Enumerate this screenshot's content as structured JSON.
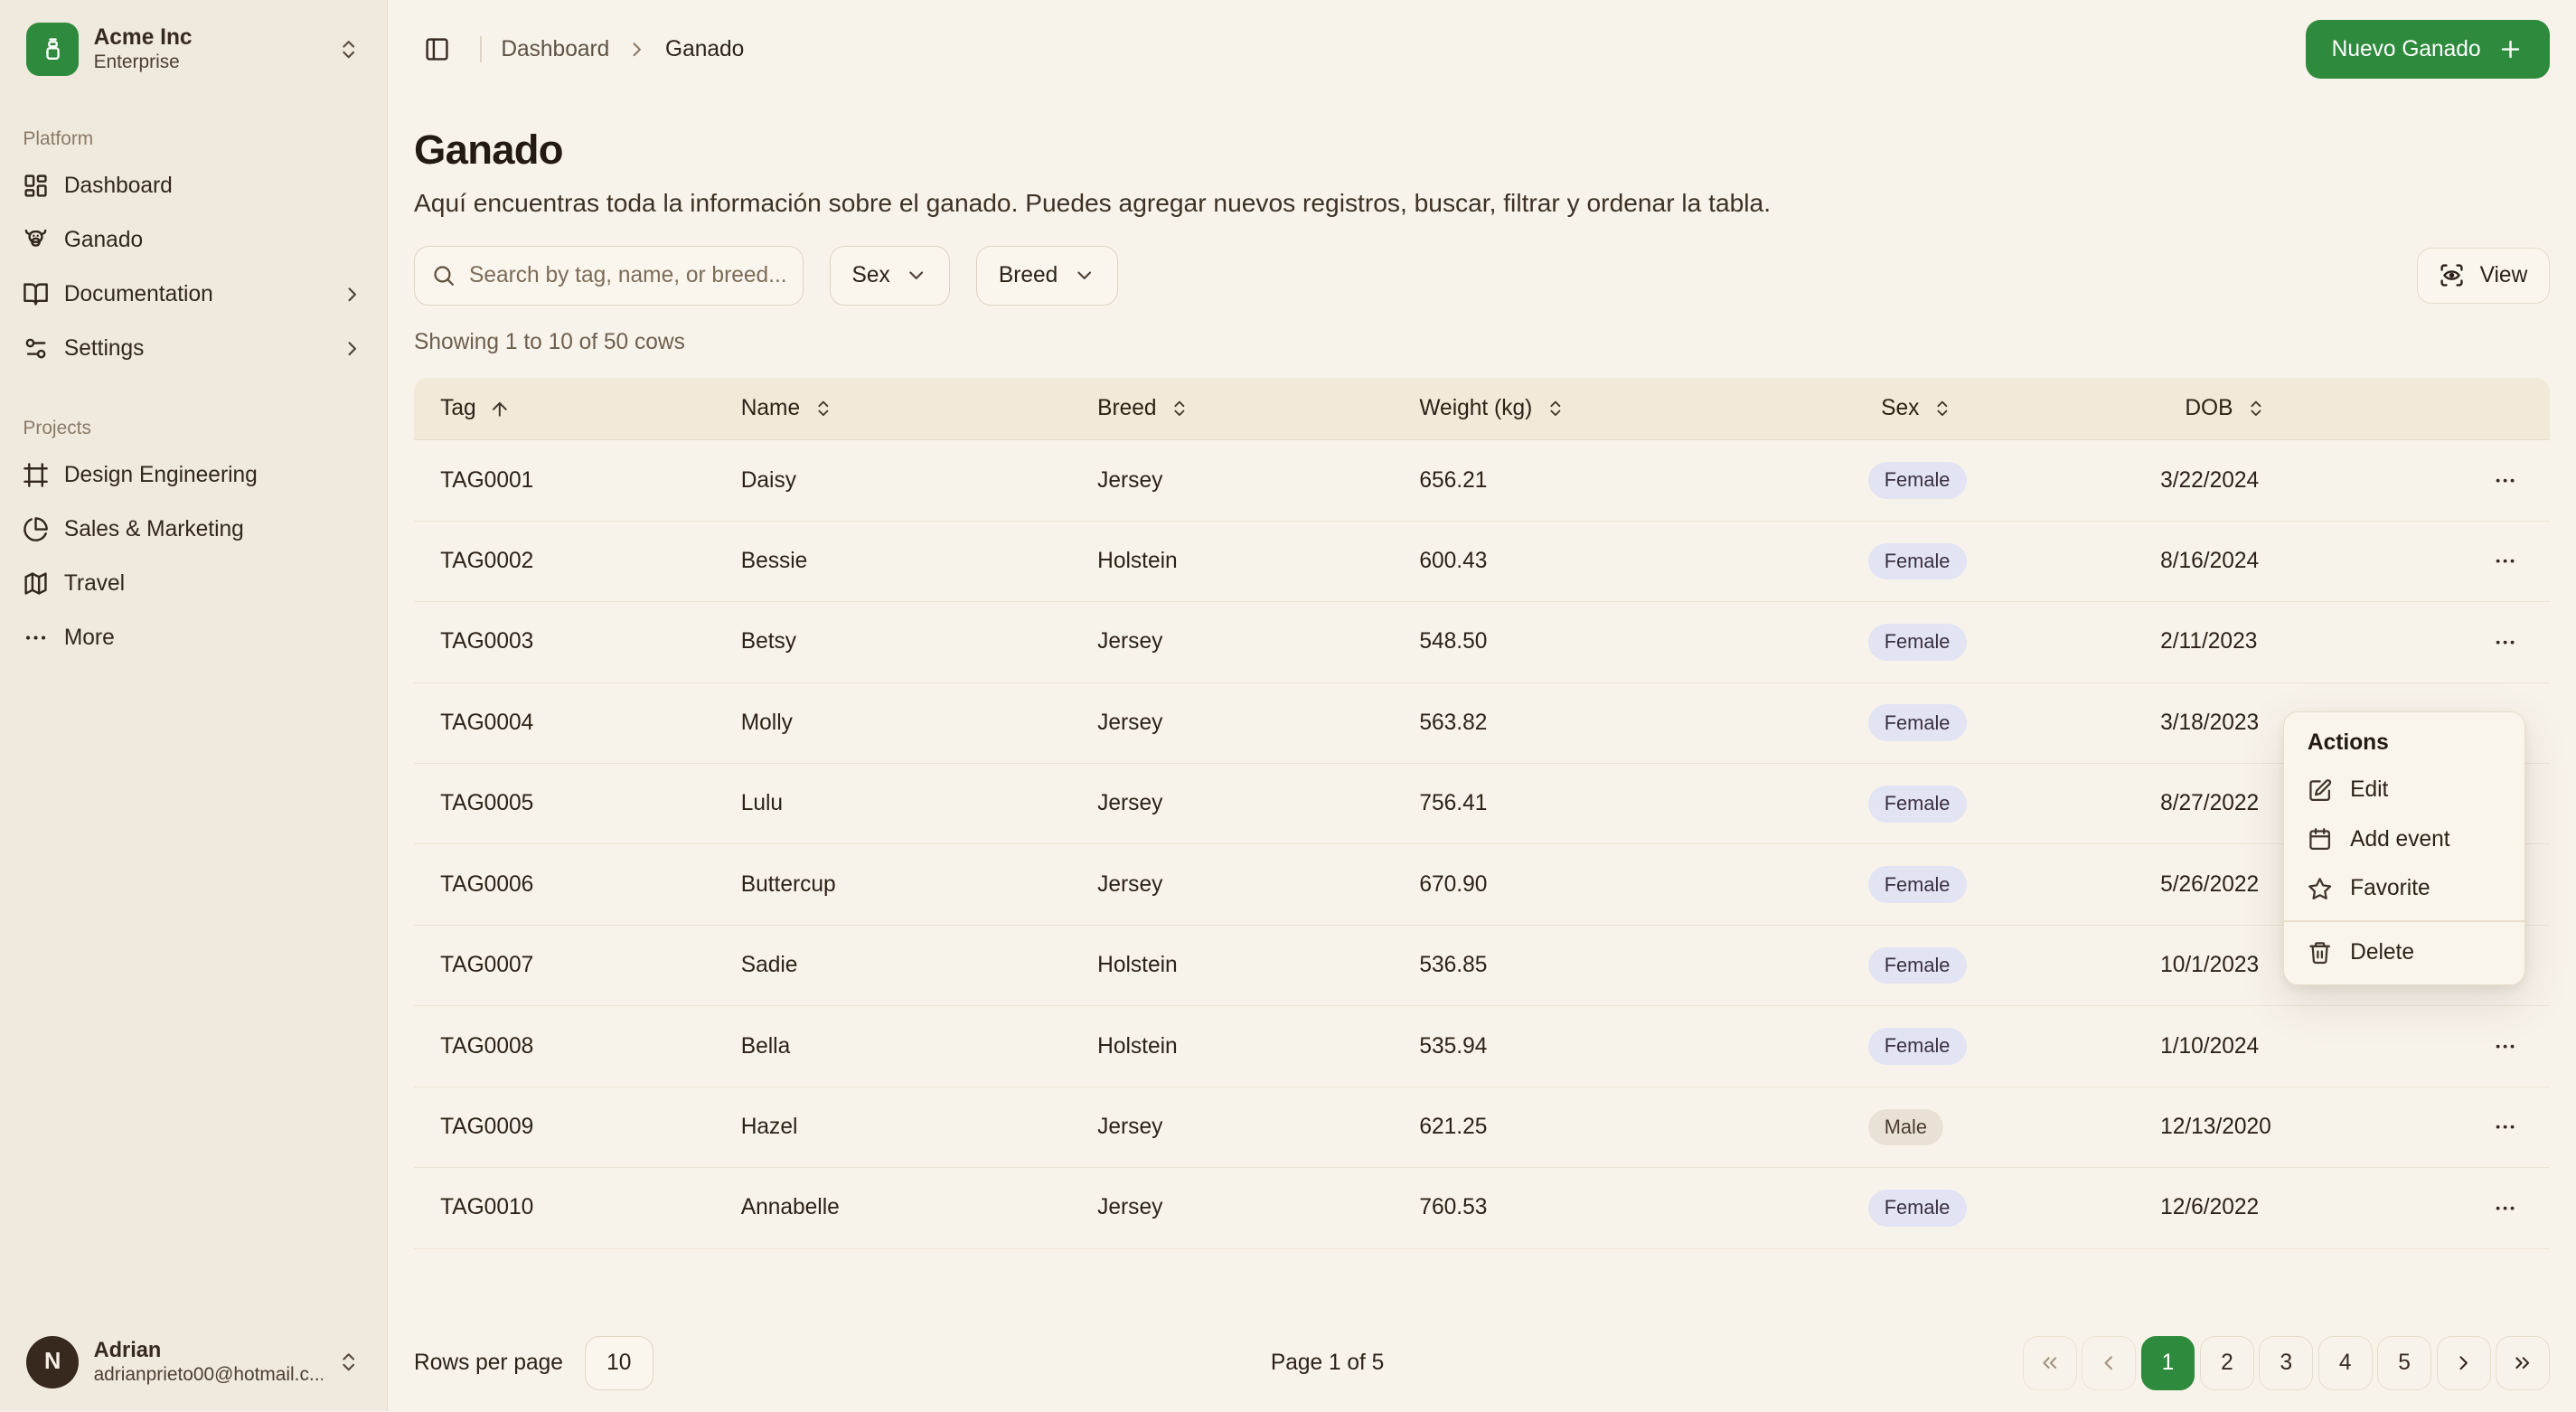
{
  "sidebar": {
    "org": {
      "name": "Acme Inc",
      "plan": "Enterprise"
    },
    "groups": [
      {
        "label": "Platform",
        "items": [
          {
            "label": "Dashboard",
            "icon": "dashboard-icon",
            "chevron": false
          },
          {
            "label": "Ganado",
            "icon": "cow-icon",
            "chevron": false
          },
          {
            "label": "Documentation",
            "icon": "book-open-icon",
            "chevron": true
          },
          {
            "label": "Settings",
            "icon": "sliders-icon",
            "chevron": true
          }
        ]
      },
      {
        "label": "Projects",
        "items": [
          {
            "label": "Design Engineering",
            "icon": "frame-icon",
            "chevron": false
          },
          {
            "label": "Sales & Marketing",
            "icon": "pie-chart-icon",
            "chevron": false
          },
          {
            "label": "Travel",
            "icon": "map-icon",
            "chevron": false
          },
          {
            "label": "More",
            "icon": "ellipsis-icon",
            "chevron": false
          }
        ]
      }
    ],
    "user": {
      "initial": "N",
      "name": "Adrian",
      "email": "adrianprieto00@hotmail.c..."
    }
  },
  "topbar": {
    "breadcrumb": {
      "parent": "Dashboard",
      "current": "Ganado"
    },
    "new_button_label": "Nuevo Ganado"
  },
  "page": {
    "title": "Ganado",
    "description": "Aquí encuentras toda la información sobre el ganado. Puedes agregar nuevos registros, buscar, filtrar y ordenar la tabla.",
    "showing": "Showing 1 to 10 of 50 cows"
  },
  "filters": {
    "search_placeholder": "Search by tag, name, or breed...",
    "sex_label": "Sex",
    "breed_label": "Breed",
    "view_label": "View"
  },
  "table": {
    "columns": [
      {
        "label": "Tag",
        "sort": "asc"
      },
      {
        "label": "Name",
        "sort": "both"
      },
      {
        "label": "Breed",
        "sort": "both"
      },
      {
        "label": "Weight (kg)",
        "sort": "both"
      },
      {
        "label": "Sex",
        "sort": "both"
      },
      {
        "label": "DOB",
        "sort": "both"
      }
    ],
    "rows": [
      {
        "tag": "TAG0001",
        "name": "Daisy",
        "breed": "Jersey",
        "weight": "656.21",
        "sex": "Female",
        "dob": "3/22/2024"
      },
      {
        "tag": "TAG0002",
        "name": "Bessie",
        "breed": "Holstein",
        "weight": "600.43",
        "sex": "Female",
        "dob": "8/16/2024"
      },
      {
        "tag": "TAG0003",
        "name": "Betsy",
        "breed": "Jersey",
        "weight": "548.50",
        "sex": "Female",
        "dob": "2/11/2023"
      },
      {
        "tag": "TAG0004",
        "name": "Molly",
        "breed": "Jersey",
        "weight": "563.82",
        "sex": "Female",
        "dob": "3/18/2023"
      },
      {
        "tag": "TAG0005",
        "name": "Lulu",
        "breed": "Jersey",
        "weight": "756.41",
        "sex": "Female",
        "dob": "8/27/2022"
      },
      {
        "tag": "TAG0006",
        "name": "Buttercup",
        "breed": "Jersey",
        "weight": "670.90",
        "sex": "Female",
        "dob": "5/26/2022"
      },
      {
        "tag": "TAG0007",
        "name": "Sadie",
        "breed": "Holstein",
        "weight": "536.85",
        "sex": "Female",
        "dob": "10/1/2023"
      },
      {
        "tag": "TAG0008",
        "name": "Bella",
        "breed": "Holstein",
        "weight": "535.94",
        "sex": "Female",
        "dob": "1/10/2024"
      },
      {
        "tag": "TAG0009",
        "name": "Hazel",
        "breed": "Jersey",
        "weight": "621.25",
        "sex": "Male",
        "dob": "12/13/2020"
      },
      {
        "tag": "TAG0010",
        "name": "Annabelle",
        "breed": "Jersey",
        "weight": "760.53",
        "sex": "Female",
        "dob": "12/6/2022"
      }
    ]
  },
  "context_menu": {
    "title": "Actions",
    "items": [
      {
        "label": "Edit",
        "icon": "edit-icon"
      },
      {
        "label": "Add event",
        "icon": "calendar-icon"
      },
      {
        "label": "Favorite",
        "icon": "star-icon"
      }
    ],
    "danger_item": {
      "label": "Delete",
      "icon": "trash-icon"
    }
  },
  "pagination": {
    "rows_per_page_label": "Rows per page",
    "rows_per_page_value": "10",
    "page_status": "Page 1 of 5",
    "pages": [
      "1",
      "2",
      "3",
      "4",
      "5"
    ],
    "active_page": "1"
  },
  "colors": {
    "accent_green": "#2e8b3d",
    "badge_female_bg": "#e2e4f4",
    "badge_male_bg": "#eae1d6",
    "sidebar_bg": "#f0e9de",
    "main_bg": "#f8f3ea"
  }
}
